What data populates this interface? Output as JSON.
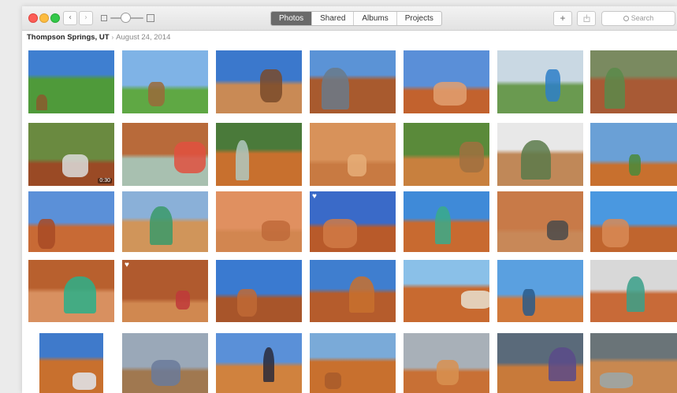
{
  "toolbar": {
    "tabs": [
      {
        "label": "Photos",
        "active": true
      },
      {
        "label": "Shared",
        "active": false
      },
      {
        "label": "Albums",
        "active": false
      },
      {
        "label": "Projects",
        "active": false
      }
    ],
    "back_icon": "chevron-left-icon",
    "forward_icon": "chevron-right-icon",
    "add_icon": "plus-icon",
    "share_icon": "share-icon",
    "search_placeholder": "Search",
    "zoom_level": 0.45
  },
  "moment": {
    "location": "Thompson Springs, UT",
    "date": "August 24, 2014"
  },
  "photos": [
    {
      "sky": "#3f7fd0",
      "ground": "#4f9a3a",
      "accent": "#8a5a2e",
      "heart": false,
      "duration": ""
    },
    {
      "sky": "#7fb3e6",
      "ground": "#5fa844",
      "accent": "#9a6a3a",
      "heart": false,
      "duration": ""
    },
    {
      "sky": "#3b78cc",
      "ground": "#c98a55",
      "accent": "#7a4a2a",
      "heart": false,
      "duration": ""
    },
    {
      "sky": "#5b93d6",
      "ground": "#a85a2e",
      "accent": "#6a7a8a",
      "heart": false,
      "duration": ""
    },
    {
      "sky": "#5a8fd8",
      "ground": "#c2622e",
      "accent": "#e2a070",
      "heart": false,
      "duration": ""
    },
    {
      "sky": "#c9d8e3",
      "ground": "#6a9a50",
      "accent": "#2d7fc8",
      "heart": false,
      "duration": ""
    },
    {
      "sky": "#7a8a60",
      "ground": "#a85a35",
      "accent": "#5a8a4a",
      "heart": false,
      "duration": ""
    },
    {
      "sky": "#6a8a40",
      "ground": "#9a4a25",
      "accent": "#dcdcdc",
      "heart": false,
      "duration": "0:30"
    },
    {
      "sky": "#b86a3a",
      "ground": "#a8c0b0",
      "accent": "#e05040",
      "heart": false,
      "duration": ""
    },
    {
      "sky": "#4a7a3a",
      "ground": "#c8702e",
      "accent": "#b0c8c0",
      "heart": false,
      "duration": ""
    },
    {
      "sky": "#d8925a",
      "ground": "#c87a42",
      "accent": "#e6ae78",
      "heart": false,
      "duration": ""
    },
    {
      "sky": "#5a8a3a",
      "ground": "#c8803e",
      "accent": "#a07040",
      "heart": false,
      "duration": ""
    },
    {
      "sky": "#e8e8e8",
      "ground": "#c08858",
      "accent": "#5a7a4a",
      "heart": false,
      "duration": ""
    },
    {
      "sky": "#6aa0d6",
      "ground": "#c8702e",
      "accent": "#4a8a3a",
      "heart": false,
      "duration": ""
    },
    {
      "sky": "#5b90d8",
      "ground": "#c86a35",
      "accent": "#a84a25",
      "heart": false,
      "duration": ""
    },
    {
      "sky": "#8ab0d8",
      "ground": "#d0955a",
      "accent": "#3a9a6a",
      "heart": false,
      "duration": ""
    },
    {
      "sky": "#e09060",
      "ground": "#d28650",
      "accent": "#c06a3a",
      "heart": false,
      "duration": ""
    },
    {
      "sky": "#3a6ac8",
      "ground": "#b85a2a",
      "accent": "#d07a45",
      "heart": true,
      "duration": ""
    },
    {
      "sky": "#3f8ad8",
      "ground": "#c86a30",
      "accent": "#3aaa8a",
      "heart": false,
      "duration": ""
    },
    {
      "sky": "#c87a48",
      "ground": "#c88858",
      "accent": "#4a4a4a",
      "heart": false,
      "duration": ""
    },
    {
      "sky": "#4a98e0",
      "ground": "#c0652e",
      "accent": "#d88a55",
      "heart": false,
      "duration": ""
    },
    {
      "sky": "#b8602e",
      "ground": "#d89060",
      "accent": "#2ab08a",
      "heart": false,
      "duration": ""
    },
    {
      "sky": "#b05a2e",
      "ground": "#d08850",
      "accent": "#c03a3a",
      "heart": true,
      "duration": ""
    },
    {
      "sky": "#3a7ad0",
      "ground": "#a8552a",
      "accent": "#c06a35",
      "heart": false,
      "duration": ""
    },
    {
      "sky": "#3f7ecf",
      "ground": "#b55c2c",
      "accent": "#c8702e",
      "heart": false,
      "duration": ""
    },
    {
      "sky": "#8ac0e8",
      "ground": "#c86a30",
      "accent": "#e8e0d0",
      "heart": false,
      "duration": ""
    },
    {
      "sky": "#5aa0e0",
      "ground": "#d0783a",
      "accent": "#2a5a8a",
      "heart": false,
      "duration": ""
    },
    {
      "sky": "#d8d8d8",
      "ground": "#c86a38",
      "accent": "#3aa08a",
      "heart": false,
      "duration": ""
    },
    {
      "sky": "#3f7acb",
      "ground": "#c8702e",
      "accent": "#e0e6ee",
      "heart": false,
      "duration": ""
    },
    {
      "sky": "#9aa8b8",
      "ground": "#a07850",
      "accent": "#6a7a9a",
      "heart": false,
      "duration": ""
    },
    {
      "sky": "#5a90d8",
      "ground": "#d0823e",
      "accent": "#2a2a3a",
      "heart": false,
      "duration": ""
    },
    {
      "sky": "#7aaad8",
      "ground": "#c8702e",
      "accent": "#a85a2a",
      "heart": false,
      "duration": ""
    },
    {
      "sky": "#a8b0b8",
      "ground": "#c87035",
      "accent": "#d89050",
      "heart": false,
      "duration": ""
    },
    {
      "sky": "#5a6a7a",
      "ground": "#c87a3a",
      "accent": "#5a4a8a",
      "heart": false,
      "duration": ""
    },
    {
      "sky": "#6a7478",
      "ground": "#c88850",
      "accent": "#9aa8aa",
      "heart": false,
      "duration": ""
    }
  ]
}
